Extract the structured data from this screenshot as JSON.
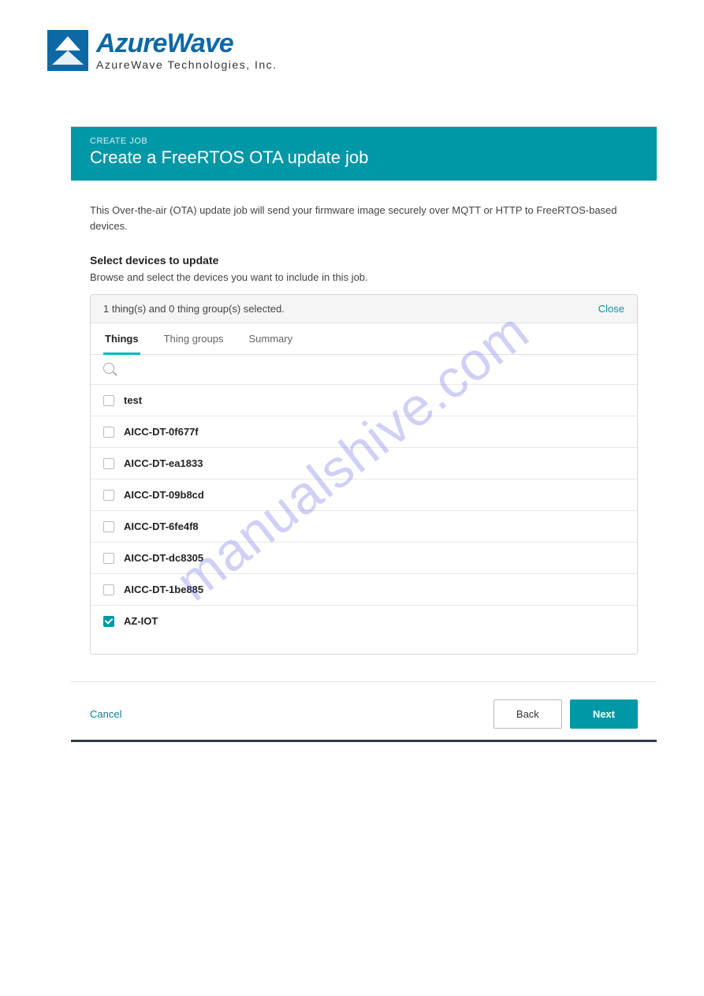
{
  "logo": {
    "main": "AzureWave",
    "sub": "AzureWave Technologies, Inc."
  },
  "watermark": "manualshive.com",
  "header": {
    "breadcrumb": "CREATE JOB",
    "title": "Create a FreeRTOS OTA update job"
  },
  "intro": "This Over-the-air (OTA) update job will send your firmware image securely over MQTT or HTTP to FreeRTOS-based devices.",
  "section": {
    "title": "Select devices to update",
    "desc": "Browse and select the devices you want to include in this job."
  },
  "picker": {
    "summary": "1 thing(s) and 0 thing group(s) selected.",
    "close": "Close",
    "tabs": {
      "things": "Things",
      "groups": "Thing groups",
      "summary": "Summary"
    },
    "things": [
      {
        "label": "test",
        "checked": false
      },
      {
        "label": "AICC-DT-0f677f",
        "checked": false
      },
      {
        "label": "AICC-DT-ea1833",
        "checked": false
      },
      {
        "label": "AICC-DT-09b8cd",
        "checked": false
      },
      {
        "label": "AICC-DT-6fe4f8",
        "checked": false
      },
      {
        "label": "AICC-DT-dc8305",
        "checked": false
      },
      {
        "label": "AICC-DT-1be885",
        "checked": false
      },
      {
        "label": "AZ-IOT",
        "checked": true
      }
    ]
  },
  "footer": {
    "cancel": "Cancel",
    "back": "Back",
    "next": "Next"
  }
}
